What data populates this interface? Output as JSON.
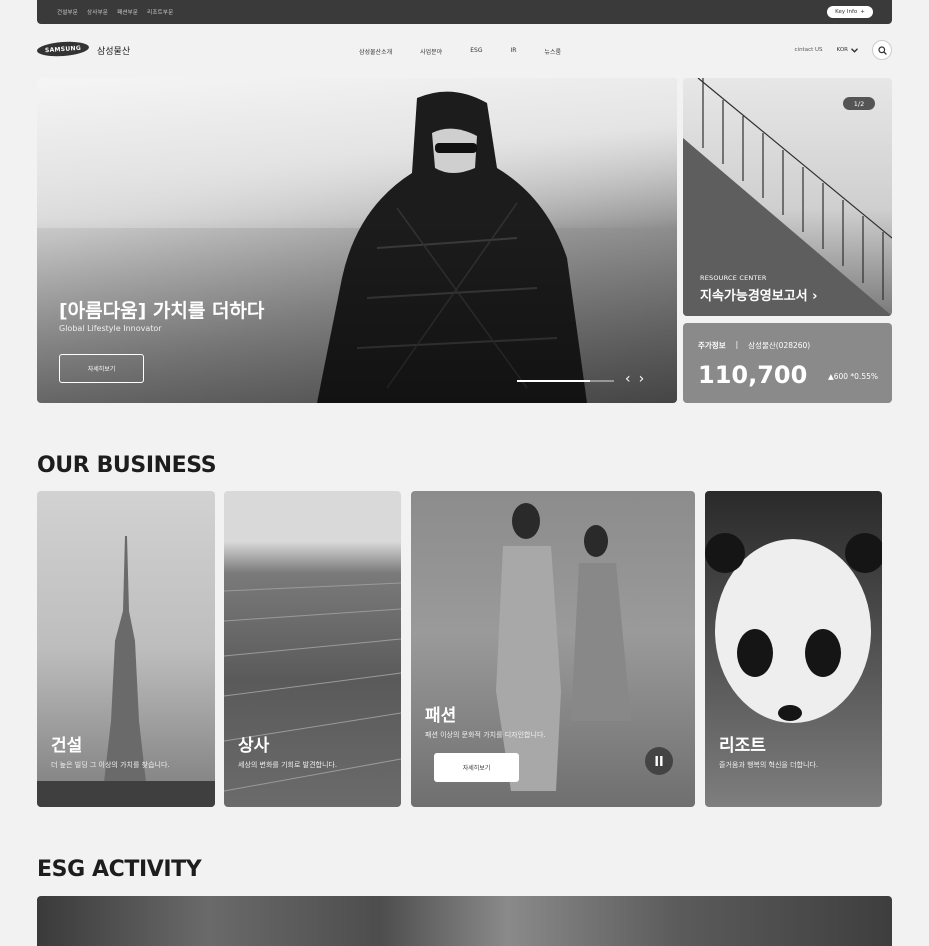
{
  "topbar": {
    "divisions": [
      "건설부문",
      "상사부문",
      "패션부문",
      "리조트부문"
    ],
    "key_info": "Key Info"
  },
  "header": {
    "logo_text": "SAMSUNG",
    "brand": "삼성물산",
    "gnb": [
      "삼성물산소개",
      "사업분야",
      "ESG",
      "IR",
      "뉴스룸"
    ],
    "contact": "cintact US",
    "lang": "KOR"
  },
  "hero": {
    "title": "[아름다움] 가치를 더하다",
    "subtitle": "Global Lifestyle Innovator",
    "button": "자세히보기",
    "progress": 0.75
  },
  "resource": {
    "pager": "1/2",
    "kicker": "RESOURCE CENTER",
    "title": "지속가능경영보고서 ›"
  },
  "stock": {
    "label": "주가정보",
    "separator": "|",
    "company": "삼성물산(028260)",
    "price": "110,700",
    "change": "▲600 *0.55%"
  },
  "business": {
    "heading": "OUR BUSINESS",
    "cards": [
      {
        "title": "건설",
        "desc": "더 높은 빌딩 그 이상의 가치를 찾습니다."
      },
      {
        "title": "상사",
        "desc": "세상의 변화를 기회로 발견합니다."
      },
      {
        "title": "패션",
        "desc": "패션 이상의 문화적 가치를 디자인합니다.",
        "button": "자세히보기"
      },
      {
        "title": "리조트",
        "desc": "즐거움과 행복의 혁신을 더합니다."
      }
    ]
  },
  "esg": {
    "heading": "ESG ACTIVITY"
  }
}
